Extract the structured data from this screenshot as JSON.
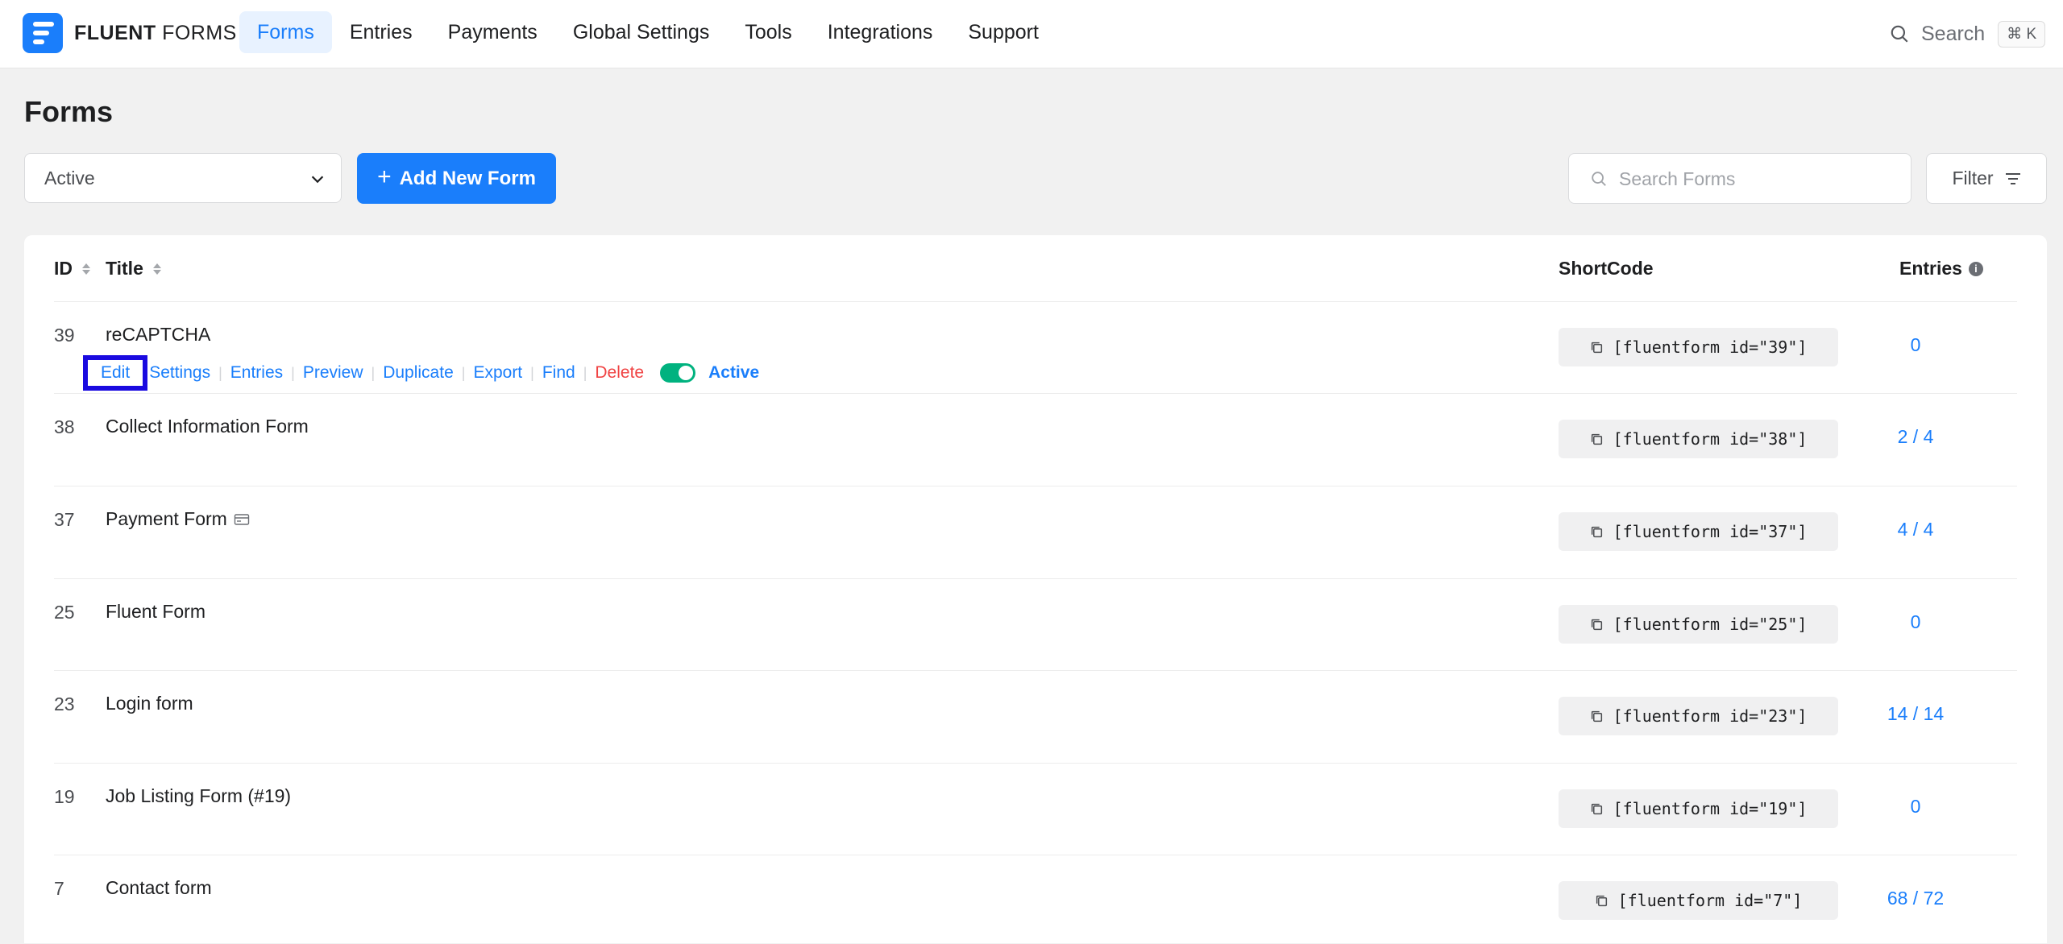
{
  "brand": {
    "name_bold": "FLUENT",
    "name_light": "FORMS"
  },
  "nav": [
    {
      "label": "Forms",
      "active": true
    },
    {
      "label": "Entries",
      "active": false
    },
    {
      "label": "Payments",
      "active": false
    },
    {
      "label": "Global Settings",
      "active": false
    },
    {
      "label": "Tools",
      "active": false
    },
    {
      "label": "Integrations",
      "active": false
    },
    {
      "label": "Support",
      "active": false
    }
  ],
  "top_search": {
    "label": "Search",
    "shortcut": "⌘ K"
  },
  "page": {
    "title": "Forms"
  },
  "toolbar": {
    "status_value": "Active",
    "add_label": "Add New Form",
    "search_placeholder": "Search Forms",
    "filter_label": "Filter"
  },
  "table": {
    "headers": {
      "id": "ID",
      "title": "Title",
      "shortcode": "ShortCode",
      "entries": "Entries"
    },
    "row_actions": {
      "edit": "Edit",
      "settings": "Settings",
      "entries": "Entries",
      "preview": "Preview",
      "duplicate": "Duplicate",
      "export": "Export",
      "find": "Find",
      "delete": "Delete",
      "status": "Active"
    },
    "rows": [
      {
        "id": "39",
        "title": "reCAPTCHA",
        "shortcode": "[fluentform id=\"39\"]",
        "entries": "0"
      },
      {
        "id": "38",
        "title": "Collect Information Form",
        "shortcode": "[fluentform id=\"38\"]",
        "entries": "2 / 4"
      },
      {
        "id": "37",
        "title": "Payment Form",
        "shortcode": "[fluentform id=\"37\"]",
        "entries": "4 / 4",
        "icon": "payment-icon"
      },
      {
        "id": "25",
        "title": "Fluent Form",
        "shortcode": "[fluentform id=\"25\"]",
        "entries": "0"
      },
      {
        "id": "23",
        "title": "Login form",
        "shortcode": "[fluentform id=\"23\"]",
        "entries": "14 / 14"
      },
      {
        "id": "19",
        "title": "Job Listing Form (#19)",
        "shortcode": "[fluentform id=\"19\"]",
        "entries": "0"
      },
      {
        "id": "7",
        "title": "Contact form",
        "shortcode": "[fluentform id=\"7\"]",
        "entries": "68 / 72"
      }
    ]
  },
  "colors": {
    "accent": "#1a7efb",
    "danger": "#f04444",
    "toggle_on": "#00b27f",
    "highlight_box": "#1a0ae0"
  }
}
